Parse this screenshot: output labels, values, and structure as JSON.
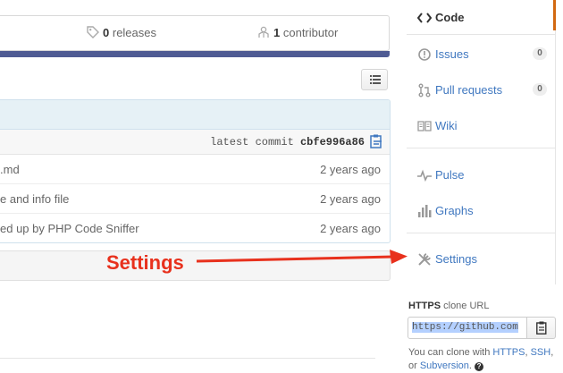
{
  "stats": {
    "releases_count": "0",
    "releases_label": "releases",
    "contributors_count": "1",
    "contributors_label": "contributor"
  },
  "colors": {
    "language_bar": "#4f5b93",
    "link": "#4078c0",
    "selected_accent": "#d26911",
    "annotation": "#e8311d"
  },
  "commit_bar": {
    "label": "latest commit",
    "hash": "cbfe996a86"
  },
  "files": [
    {
      "message": ".md",
      "age": "2 years ago"
    },
    {
      "message": "e and info file",
      "age": "2 years ago"
    },
    {
      "message": "ed up by PHP Code Sniffer",
      "age": "2 years ago"
    }
  ],
  "sidebar": {
    "code": {
      "label": "Code",
      "icon": "code-icon"
    },
    "issues": {
      "label": "Issues",
      "count": "0",
      "icon": "issue-icon"
    },
    "pull_requests": {
      "label": "Pull requests",
      "count": "0",
      "icon": "pull-request-icon"
    },
    "wiki": {
      "label": "Wiki",
      "icon": "book-icon"
    },
    "pulse": {
      "label": "Pulse",
      "icon": "pulse-icon"
    },
    "graphs": {
      "label": "Graphs",
      "icon": "graph-icon"
    },
    "settings": {
      "label": "Settings",
      "icon": "tools-icon"
    }
  },
  "clone": {
    "protocol": "HTTPS",
    "title_rest": "clone URL",
    "url_value": "https://github.com",
    "help_prefix": "You can clone with",
    "https_link": "HTTPS",
    "ssh_link": "SSH",
    "or": "or",
    "subversion_link": "Subversion",
    "help_q": "?"
  },
  "annotation": {
    "label": "Settings"
  }
}
